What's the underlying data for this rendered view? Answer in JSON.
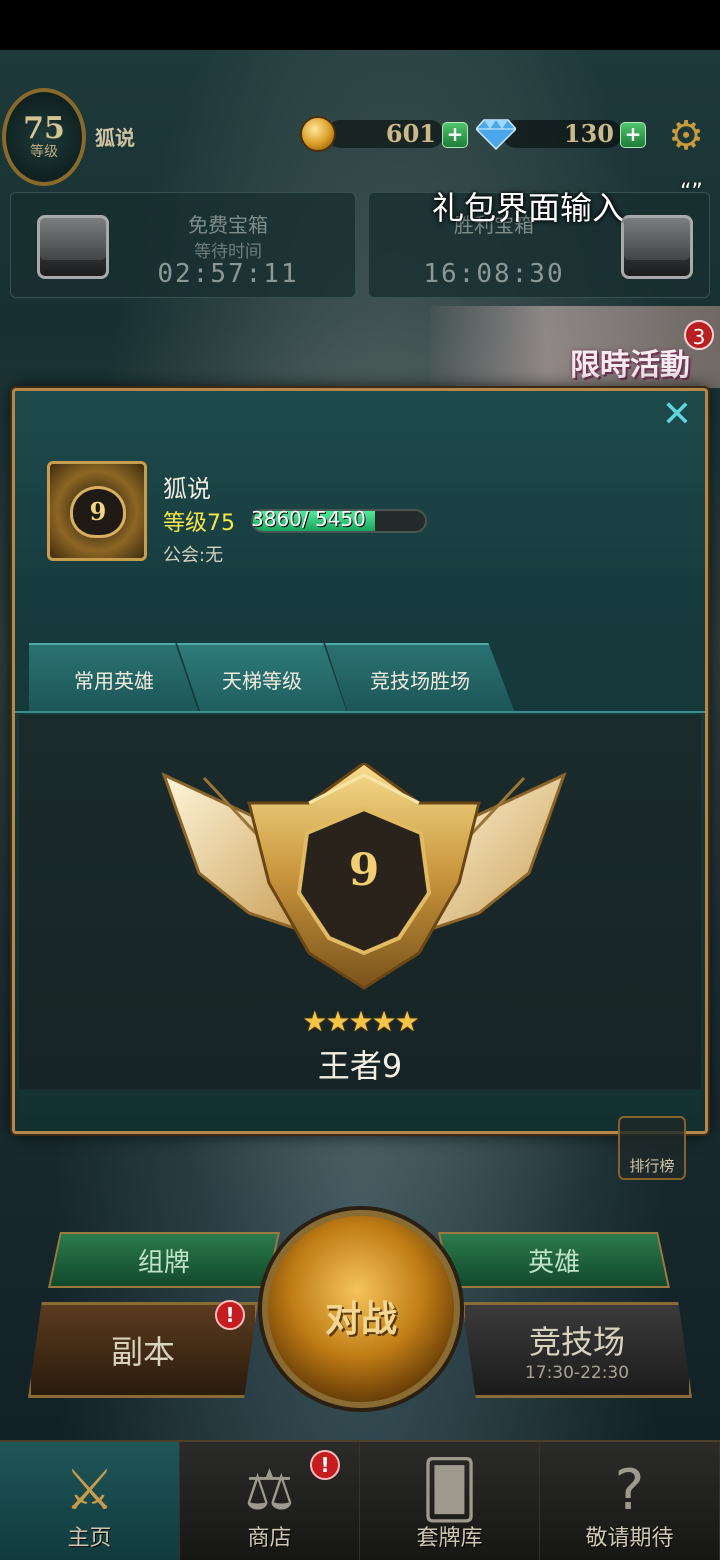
{
  "header": {
    "level": "75",
    "level_label": "等级",
    "player_name": "狐说",
    "gold": "601",
    "gems": "130",
    "plus": "+"
  },
  "overlay": {
    "text": "礼包界面输入",
    "quote": "“”"
  },
  "chests": {
    "free": {
      "title": "免费宝箱",
      "wait_label": "等待时间",
      "time": "02:57:11"
    },
    "victory": {
      "title": "胜利宝箱",
      "time": "16:08:30"
    }
  },
  "event": {
    "label": "限時活動",
    "badge": "3"
  },
  "profile": {
    "close": "✕",
    "badge_number": "9",
    "name": "狐说",
    "level_text": "等级75",
    "xp_text": "3860/ 5450",
    "xp_fraction": 0.708,
    "guild_text": "公会:无",
    "tabs": [
      "常用英雄",
      "天梯等级",
      "竞技场胜场"
    ],
    "active_tab": 1,
    "rank": {
      "number": "9",
      "stars": "★★★★★",
      "star_count": 5,
      "name": "王者9"
    }
  },
  "controls": {
    "leaderboard": "排行榜",
    "deck": "组牌",
    "hero": "英雄",
    "battle": "对战",
    "dungeon": "副本",
    "arena": "竞技场",
    "arena_time": "17:30-22:30",
    "alert": "!"
  },
  "nav": [
    {
      "label": "主页",
      "icon": "crossed-swords-icon",
      "active": true
    },
    {
      "label": "商店",
      "icon": "scales-icon",
      "active": false
    },
    {
      "label": "套牌库",
      "icon": "cards-icon",
      "active": false
    },
    {
      "label": "敬请期待",
      "icon": "question-icon",
      "active": false
    }
  ],
  "colors": {
    "accent_gold": "#c79d4e",
    "teal": "#2b7272",
    "xp_green": "#17a45f",
    "alert_red": "#c51d1f"
  }
}
